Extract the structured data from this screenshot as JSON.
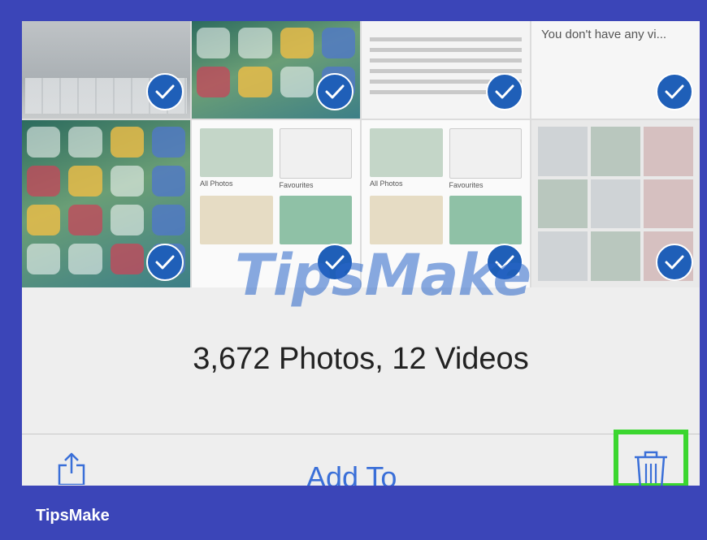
{
  "summary": {
    "count_label": "3,672 Photos, 12 Videos"
  },
  "toolbar": {
    "add_to_label": "Add To"
  },
  "tiles": [
    {
      "type": "settings"
    },
    {
      "type": "home"
    },
    {
      "type": "article"
    },
    {
      "type": "empty",
      "text": "You don't have any vi..."
    },
    {
      "type": "home"
    },
    {
      "type": "albums",
      "labels": [
        "All Photos",
        "Favourites"
      ]
    },
    {
      "type": "albums",
      "labels": [
        "All Photos",
        "Favourites"
      ]
    },
    {
      "type": "collage"
    }
  ],
  "watermark": {
    "text": "TipsMake"
  },
  "brand": {
    "label": "TipsMake"
  },
  "colors": {
    "accent": "#3a6fd8",
    "check": "#1f5fb8",
    "highlight": "#3bd62f",
    "frame": "#3b45b8"
  },
  "icons": [
    "checkmark-icon",
    "share-icon",
    "trash-icon"
  ]
}
